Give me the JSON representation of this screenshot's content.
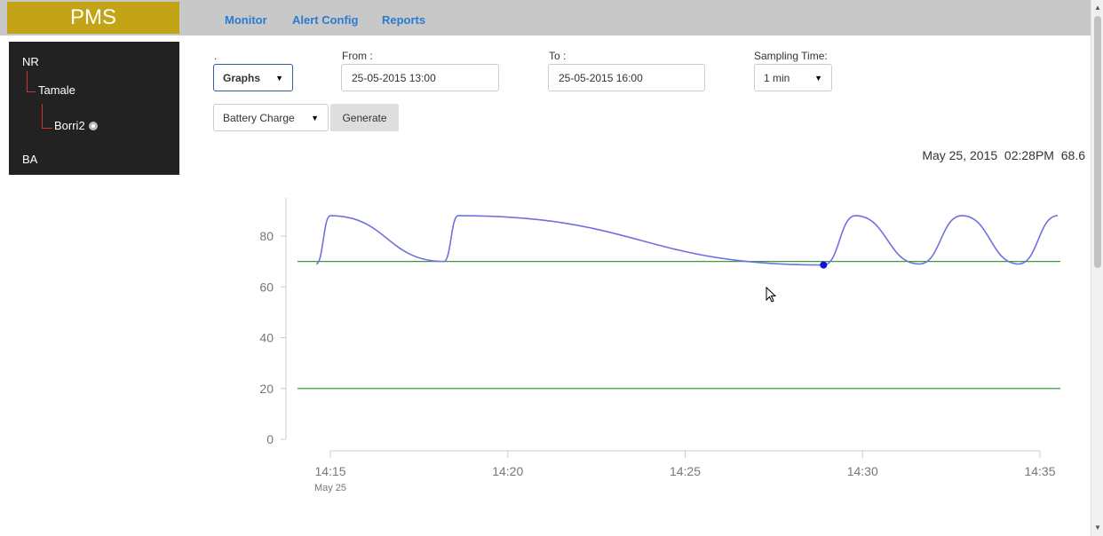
{
  "app": {
    "logo": "PMS"
  },
  "nav": {
    "items": [
      "Monitor",
      "Alert Config",
      "Reports"
    ]
  },
  "tree": {
    "nodes": [
      {
        "label": "NR"
      },
      {
        "label": "Tamale"
      },
      {
        "label": "Borri2"
      },
      {
        "label": "BA"
      }
    ]
  },
  "controls": {
    "view_label": ".",
    "view_value": "Graphs",
    "from_label": "From :",
    "from_value": "25-05-2015 13:00",
    "to_label": "To :",
    "to_value": "25-05-2015 16:00",
    "sampling_label": "Sampling Time:",
    "sampling_value": "1 min",
    "parameter_value": "Battery Charge",
    "generate_label": "Generate"
  },
  "readout": {
    "timestamp": "May 25, 2015  02:28PM",
    "value": "68.6"
  },
  "chart_data": {
    "type": "line",
    "x_ticks": [
      "14:15",
      "14:20",
      "14:25",
      "14:30",
      "14:35"
    ],
    "x_subtick": "May 25",
    "y_ticks": [
      0,
      20,
      40,
      60,
      80
    ],
    "ylim": [
      0,
      95
    ],
    "series": [
      {
        "color": "#7070e0",
        "points": [
          {
            "x": "14:14:36",
            "y": 69
          },
          {
            "x": "14:15:00",
            "y": 88
          },
          {
            "x": "14:18:12",
            "y": 70
          },
          {
            "x": "14:18:36",
            "y": 88
          },
          {
            "x": "14:28:54",
            "y": 68.6
          },
          {
            "x": "14:29:48",
            "y": 88
          },
          {
            "x": "14:31:36",
            "y": 69
          },
          {
            "x": "14:32:48",
            "y": 88
          },
          {
            "x": "14:34:24",
            "y": 69
          },
          {
            "x": "14:35:30",
            "y": 88
          }
        ]
      }
    ],
    "thresholds": [
      {
        "y": 70,
        "color": "#3a9a3a"
      },
      {
        "y": 20,
        "color": "#3a9a3a"
      }
    ],
    "highlight": {
      "x": "14:28:54",
      "y": 68.6,
      "color": "#1010e0"
    }
  }
}
